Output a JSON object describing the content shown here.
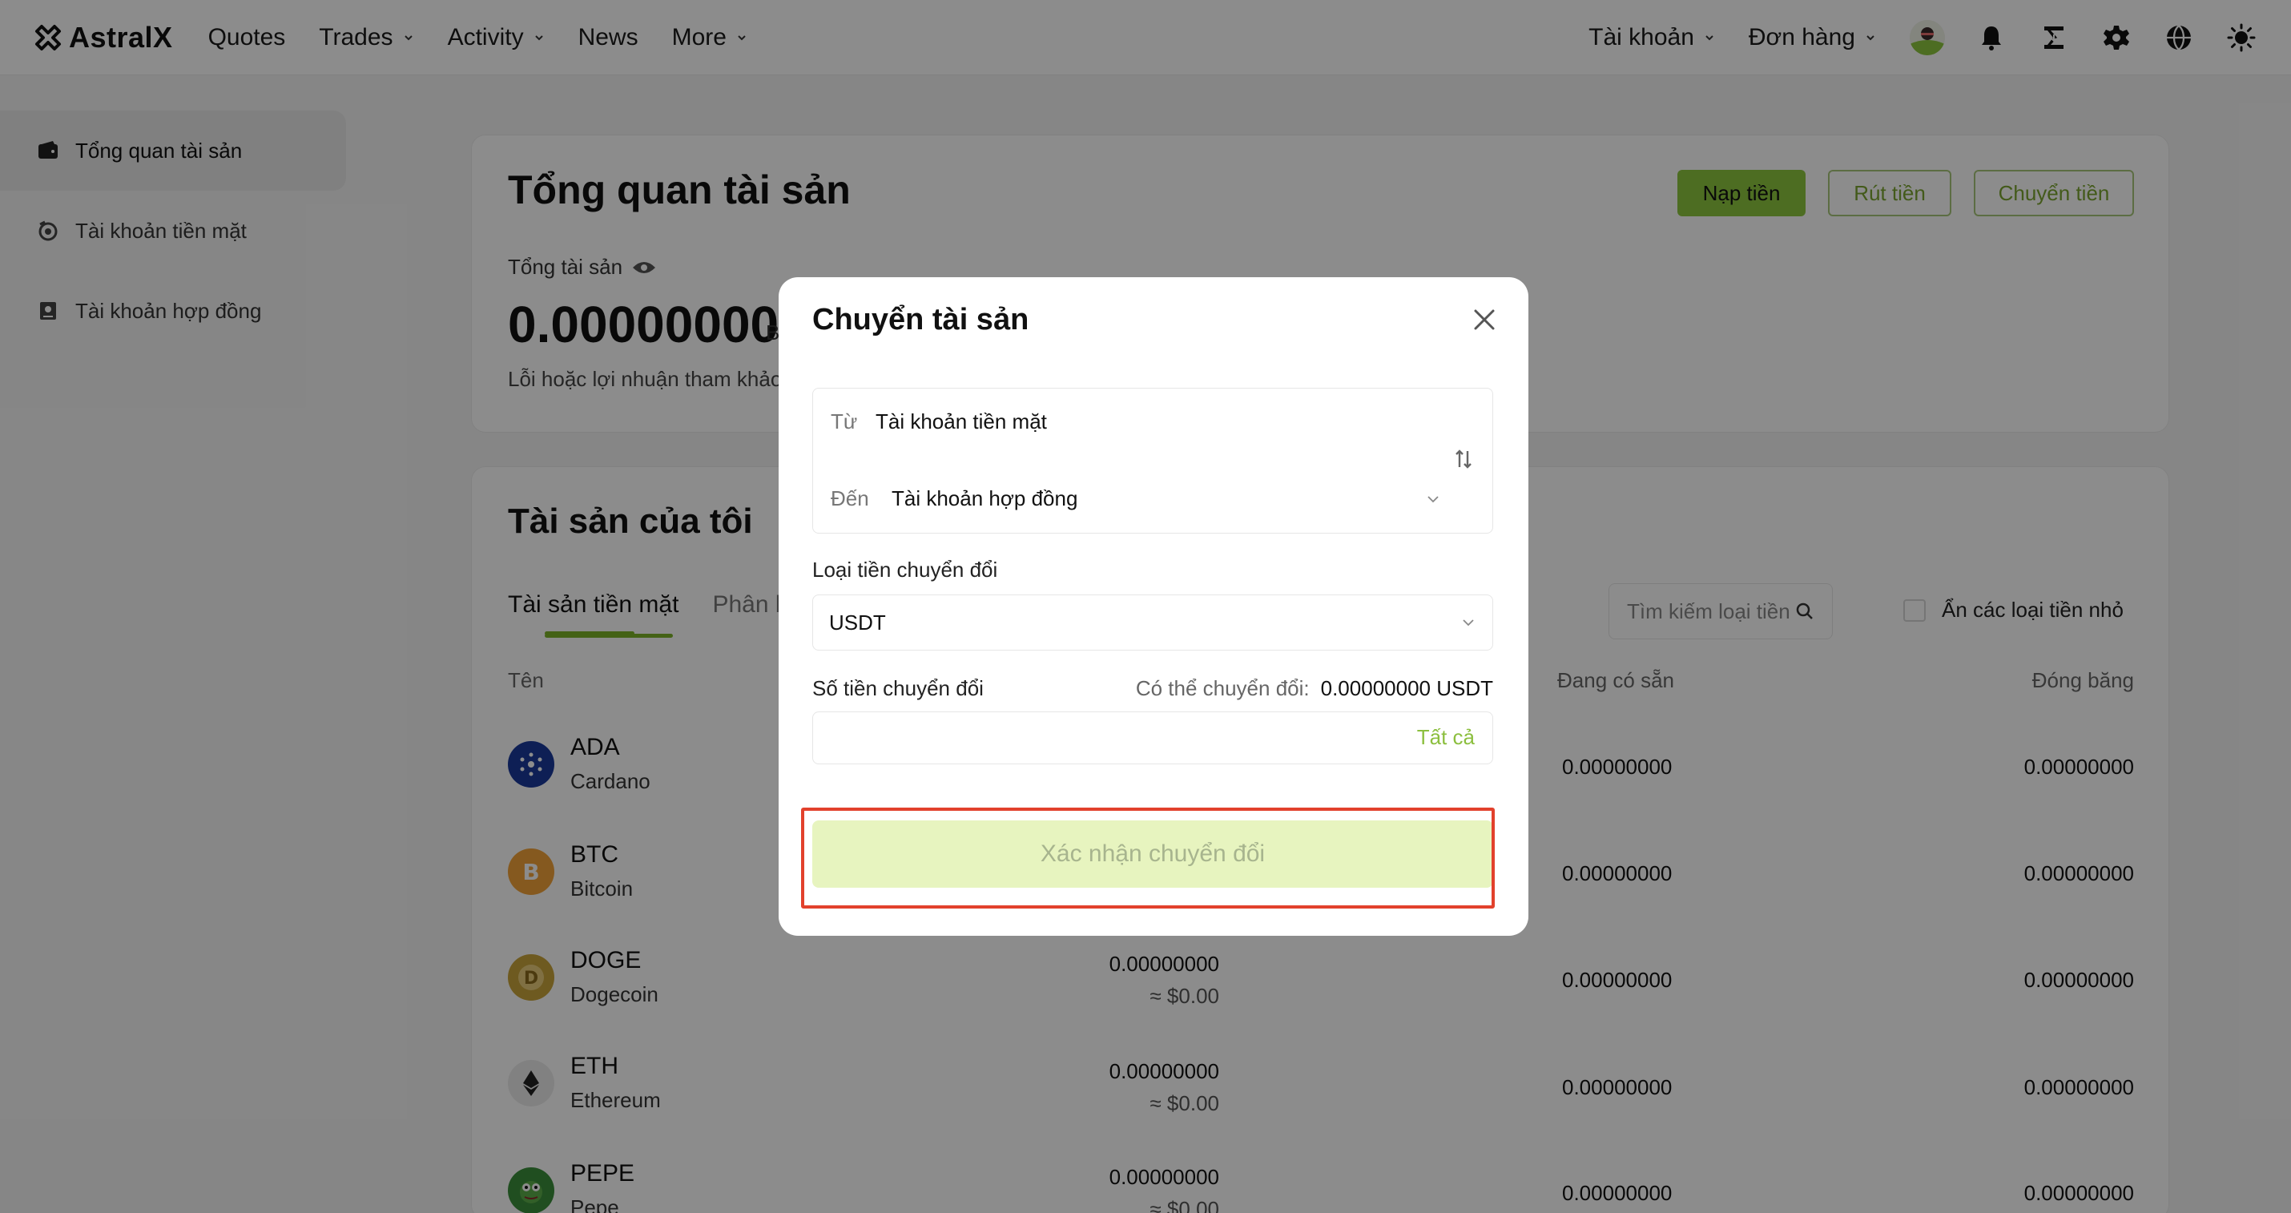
{
  "nav": {
    "brand": "AstralX",
    "items": [
      {
        "label": "Quotes",
        "has_dropdown": false
      },
      {
        "label": "Trades",
        "has_dropdown": true
      },
      {
        "label": "Activity",
        "has_dropdown": true
      },
      {
        "label": "News",
        "has_dropdown": false
      },
      {
        "label": "More",
        "has_dropdown": true
      }
    ],
    "right": {
      "account": "Tài khoản",
      "orders": "Đơn hàng"
    },
    "icons": [
      "avatar",
      "bell-icon",
      "download-app-icon",
      "gear-icon",
      "globe-icon",
      "theme-sun-icon"
    ]
  },
  "sidebar": {
    "items": [
      {
        "label": "Tổng quan tài sản",
        "icon": "wallet-icon",
        "active": true
      },
      {
        "label": "Tài khoản tiền mặt",
        "icon": "cash-account-icon",
        "active": false
      },
      {
        "label": "Tài khoản hợp đồng",
        "icon": "contract-account-icon",
        "active": false
      }
    ]
  },
  "overview": {
    "title": "Tổng quan tài sản",
    "total_label": "Tổng tài sản",
    "total_value": "0.00000000",
    "total_unit_partial": "B",
    "pnl_partial": "Lỗi hoặc lợi nhuận tham khảo",
    "buttons": {
      "deposit": "Nạp tiền",
      "withdraw": "Rút tiền",
      "transfer": "Chuyển tiền"
    }
  },
  "assets": {
    "title": "Tài sản của tôi",
    "tabs": [
      "Tài sản tiền mặt",
      "Phân b"
    ],
    "search_placeholder": "Tìm kiếm loại tiền",
    "hide_small": "Ẩn các loại tiền nhỏ",
    "columns": {
      "name": "Tên",
      "available": "Đang có sẵn",
      "frozen": "Đóng băng"
    },
    "rows": [
      {
        "symbol": "ADA",
        "name": "Cardano",
        "total": "",
        "usd": "",
        "available": "0.00000000",
        "frozen": "0.00000000",
        "color": "#1b3a9b"
      },
      {
        "symbol": "BTC",
        "name": "Bitcoin",
        "total": "",
        "usd": "",
        "available": "0.00000000",
        "frozen": "0.00000000",
        "color": "#f2a33a"
      },
      {
        "symbol": "DOGE",
        "name": "Dogecoin",
        "total": "0.00000000",
        "usd": "≈ $0.00",
        "available": "0.00000000",
        "frozen": "0.00000000",
        "color": "#c9a43b"
      },
      {
        "symbol": "ETH",
        "name": "Ethereum",
        "total": "0.00000000",
        "usd": "≈ $0.00",
        "available": "0.00000000",
        "frozen": "0.00000000",
        "color": "#e5e5e5"
      },
      {
        "symbol": "PEPE",
        "name": "Pepe",
        "total": "0.00000000",
        "usd": "≈ $0.00",
        "available": "0.00000000",
        "frozen": "0.00000000",
        "color": "#3b8f3b"
      }
    ]
  },
  "modal": {
    "title": "Chuyển tài sản",
    "from_label": "Từ",
    "from_value": "Tài khoản tiền mặt",
    "to_label": "Đến",
    "to_value": "Tài khoản hợp đồng",
    "currency_label": "Loại tiền chuyển đổi",
    "currency_value": "USDT",
    "amount_label": "Số tiền chuyển đổi",
    "available_label": "Có thể chuyển đổi:",
    "available_value": "0.00000000 USDT",
    "amount_value": "",
    "all_label": "Tất cả",
    "confirm_label": "Xác nhận chuyển đổi"
  }
}
